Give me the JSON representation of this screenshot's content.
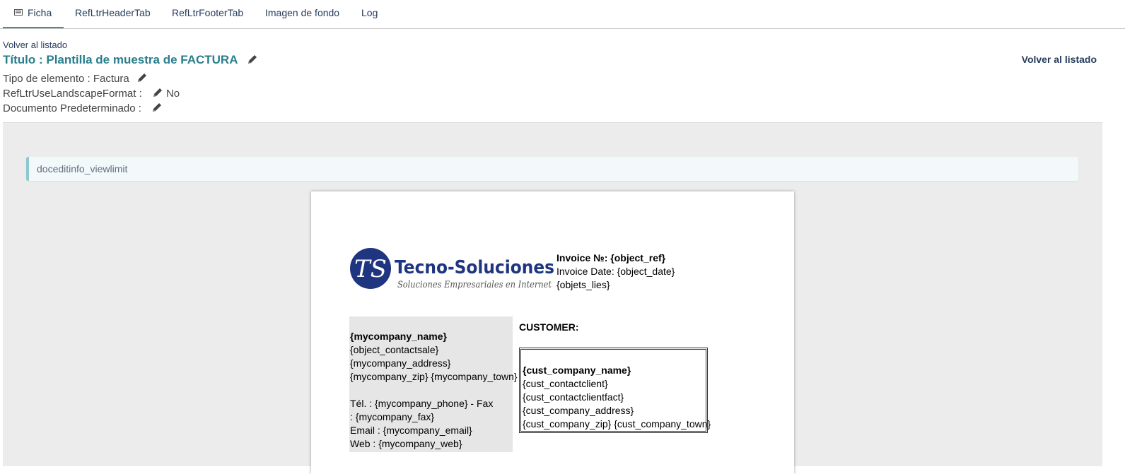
{
  "tabs": [
    {
      "label": "Ficha",
      "icon": "card-icon",
      "active": true
    },
    {
      "label": "RefLtrHeaderTab"
    },
    {
      "label": "RefLtrFooterTab"
    },
    {
      "label": "Imagen de fondo"
    },
    {
      "label": "Log"
    }
  ],
  "header": {
    "back_link": "Volver al listado",
    "title": "Título : Plantilla de muestra de FACTURA",
    "back_link_right": "Volver al listado",
    "props": [
      {
        "label": "Tipo de elemento : Factura",
        "value": ""
      },
      {
        "label": "RefLtrUseLandscapeFormat :",
        "value": "No"
      },
      {
        "label": "Documento Predeterminado :",
        "value": ""
      }
    ]
  },
  "editor": {
    "info_message": "doceditinfo_viewlimit",
    "logo": {
      "name": "Tecno-Soluciones",
      "tagline": "Soluciones Empresariales en Internet",
      "monogram": "TS"
    },
    "invoice": {
      "ref_label": "Invoice №: ",
      "ref_value": "{object_ref}",
      "date_line": "Invoice Date: {object_date}",
      "linked_line": "{objets_lies}"
    },
    "company": {
      "name": "{mycompany_name}",
      "lines": [
        "{object_contactsale}",
        "{mycompany_address}",
        "{mycompany_zip} {mycompany_town}",
        "",
        "Tél. : {mycompany_phone} - Fax",
        ": {mycompany_fax}",
        "Email : {mycompany_email}",
        "Web : {mycompany_web}"
      ]
    },
    "customer": {
      "label": "CUSTOMER:",
      "name": "{cust_company_name}",
      "lines": [
        "{cust_contactclient}",
        "{cust_contactclientfact}",
        "{cust_company_address}",
        "{cust_company_zip} {cust_company_town}"
      ]
    }
  },
  "colors": {
    "tab_active_underline": "#4e8a8a",
    "title": "#297e8c",
    "link": "#263c5c",
    "editor_bg": "#ececec",
    "info_border": "#8ec9cf",
    "logo_blue": "#1f3580"
  }
}
